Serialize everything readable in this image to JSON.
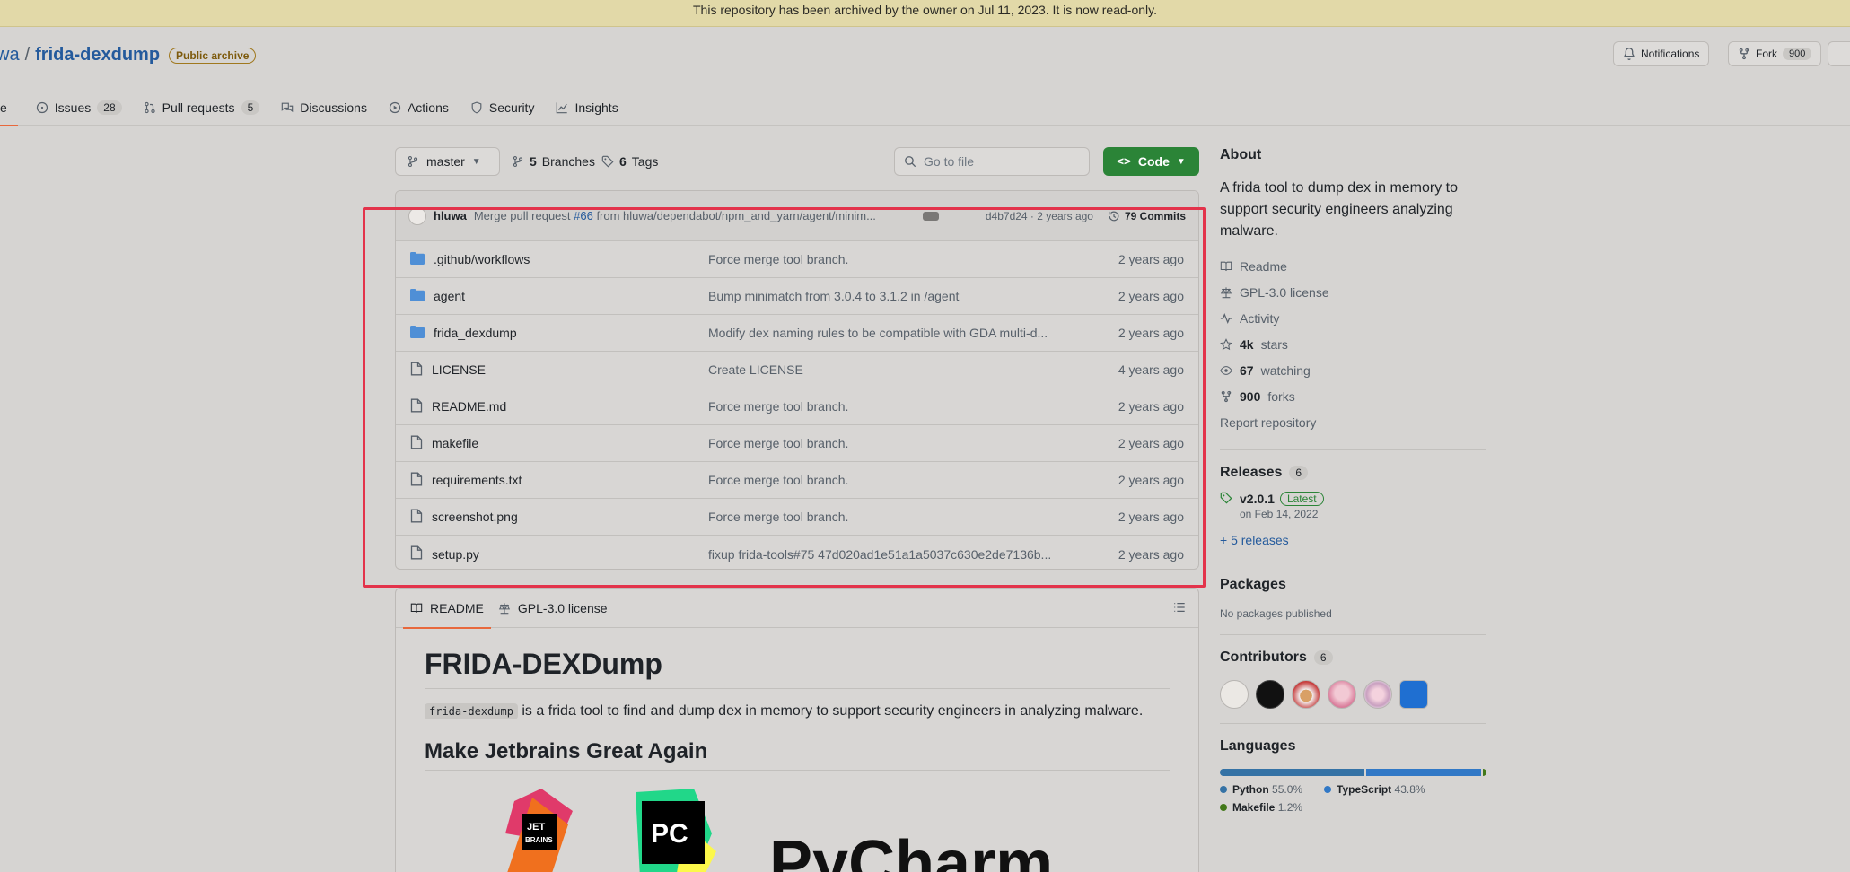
{
  "banner": "This repository has been archived by the owner on Jul 11, 2023. It is now read-only.",
  "repo": {
    "owner": "wa",
    "separator": "/",
    "name": "frida-dexdump",
    "badge": "Public archive"
  },
  "header_buttons": {
    "notifications": "Notifications",
    "fork": "Fork",
    "fork_count": "900"
  },
  "tabs": [
    {
      "label": "e",
      "count": ""
    },
    {
      "label": "Issues",
      "count": "28"
    },
    {
      "label": "Pull requests",
      "count": "5"
    },
    {
      "label": "Discussions",
      "count": ""
    },
    {
      "label": "Actions",
      "count": ""
    },
    {
      "label": "Security",
      "count": ""
    },
    {
      "label": "Insights",
      "count": ""
    }
  ],
  "toolbar": {
    "branch": "master",
    "branches": "5",
    "branches_label": "Branches",
    "tags": "6",
    "tags_label": "Tags",
    "search_placeholder": "Go to file",
    "code": "Code"
  },
  "commit": {
    "author": "hluwa",
    "msg_prefix": "Merge pull request ",
    "pr": "#66",
    "msg_suffix": " from hluwa/dependabot/npm_and_yarn/agent/minim...",
    "hash_age": "d4b7d24 · 2 years ago",
    "commits": "79 Commits"
  },
  "files": [
    {
      "type": "folder",
      "name": ".github/workflows",
      "message": "Force merge tool branch.",
      "age": "2 years ago"
    },
    {
      "type": "folder",
      "name": "agent",
      "message": "Bump minimatch from 3.0.4 to 3.1.2 in /agent",
      "age": "2 years ago"
    },
    {
      "type": "folder",
      "name": "frida_dexdump",
      "message": "Modify dex naming rules to be compatible with GDA multi-d...",
      "age": "2 years ago"
    },
    {
      "type": "file",
      "name": "LICENSE",
      "message": "Create LICENSE",
      "age": "4 years ago"
    },
    {
      "type": "file",
      "name": "README.md",
      "message": "Force merge tool branch.",
      "age": "2 years ago"
    },
    {
      "type": "file",
      "name": "makefile",
      "message": "Force merge tool branch.",
      "age": "2 years ago"
    },
    {
      "type": "file",
      "name": "requirements.txt",
      "message": "Force merge tool branch.",
      "age": "2 years ago"
    },
    {
      "type": "file",
      "name": "screenshot.png",
      "message": "Force merge tool branch.",
      "age": "2 years ago"
    },
    {
      "type": "file",
      "name": "setup.py",
      "message": "fixup frida-tools#75 47d020ad1e51a1a5037c630e2de7136b...",
      "age": "2 years ago"
    }
  ],
  "readme": {
    "tab_readme": "README",
    "tab_license": "GPL-3.0 license",
    "title": "FRIDA-DEXDump",
    "intro_code": "frida-dexdump",
    "intro_text": " is a frida tool to find and dump dex in memory to support security engineers in analyzing malware.",
    "h2": "Make Jetbrains Great Again",
    "logo_jet": "JET",
    "logo_brains": "BRAINS",
    "logo_pc": "PC",
    "logo_word": "PyCharm"
  },
  "about": {
    "title": "About",
    "description": "A frida tool to dump dex in memory to support security engineers analyzing malware.",
    "readme": "Readme",
    "license": "GPL-3.0 license",
    "activity": "Activity",
    "stars_n": "4k",
    "stars": "stars",
    "watching_n": "67",
    "watching": "watching",
    "forks_n": "900",
    "forks": "forks",
    "report": "Report repository"
  },
  "releases": {
    "title": "Releases",
    "count": "6",
    "version": "v2.0.1",
    "latest": "Latest",
    "date": "on Feb 14, 2022",
    "more": "+ 5 releases"
  },
  "packages": {
    "title": "Packages",
    "text": "No packages published"
  },
  "contributors": {
    "title": "Contributors",
    "count": "6"
  },
  "languages": {
    "title": "Languages",
    "items": [
      {
        "name": "Python",
        "pct": "55.0%",
        "value": 55.0,
        "color": "#3572A5"
      },
      {
        "name": "TypeScript",
        "pct": "43.8%",
        "value": 43.8,
        "color": "#3178c6"
      },
      {
        "name": "Makefile",
        "pct": "1.2%",
        "value": 1.2,
        "color": "#427819"
      }
    ]
  }
}
